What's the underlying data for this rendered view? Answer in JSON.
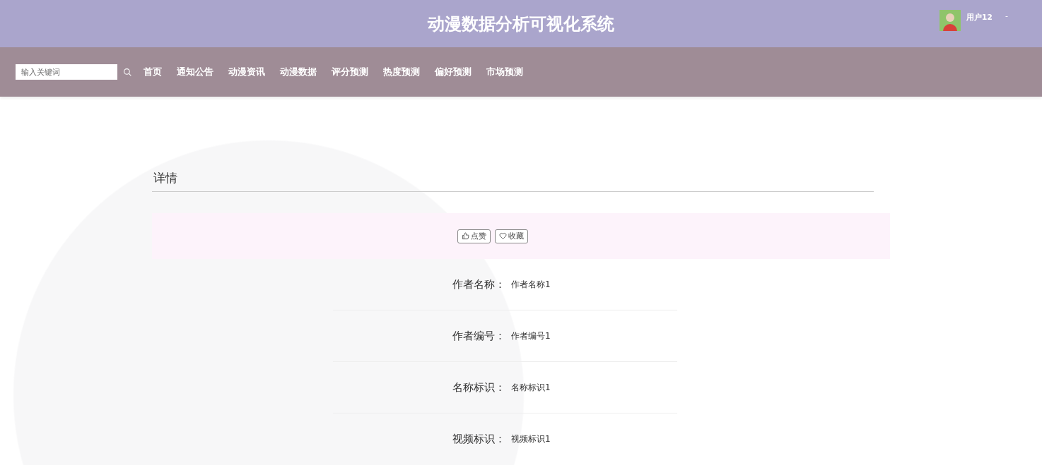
{
  "header": {
    "title": "动漫数据分析可视化系统",
    "user": "用户12",
    "menu_caret": "-"
  },
  "search": {
    "placeholder": "输入关键词"
  },
  "nav": [
    {
      "label": "首页"
    },
    {
      "label": "通知公告"
    },
    {
      "label": "动漫资讯"
    },
    {
      "label": "动漫数据"
    },
    {
      "label": "评分预测"
    },
    {
      "label": "热度预测"
    },
    {
      "label": "偏好预测"
    },
    {
      "label": "市场预测"
    }
  ],
  "detail": {
    "title": "详情",
    "actions": [
      {
        "kind": "like",
        "label": "点赞"
      },
      {
        "kind": "favorite",
        "label": "收藏"
      }
    ],
    "fields": [
      {
        "label": "作者名称：",
        "value": "作者名称1"
      },
      {
        "label": "作者编号：",
        "value": "作者编号1"
      },
      {
        "label": "名称标识：",
        "value": "名称标识1"
      },
      {
        "label": "视频标识：",
        "value": "视频标识1"
      }
    ]
  }
}
